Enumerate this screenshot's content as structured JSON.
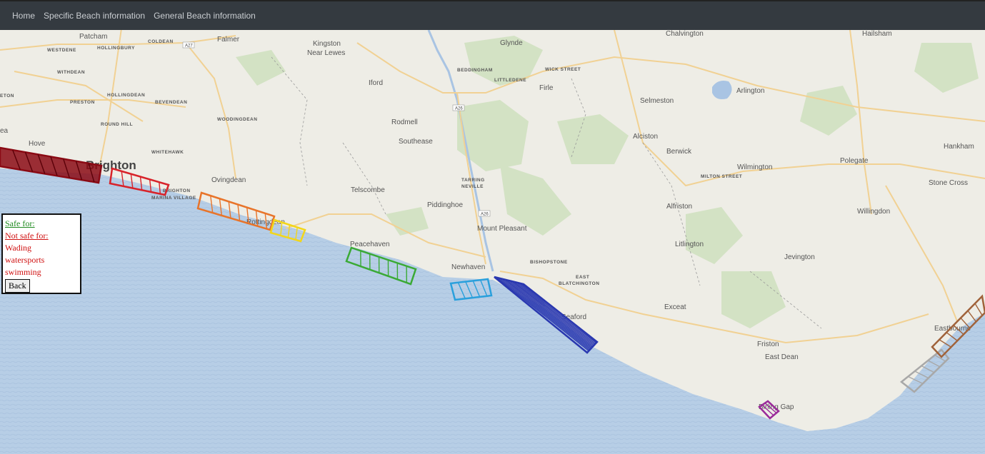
{
  "nav": {
    "items": [
      {
        "label": "Home"
      },
      {
        "label": "Specific Beach information"
      },
      {
        "label": "General Beach information"
      }
    ]
  },
  "map": {
    "colors": {
      "land": "#eeede6",
      "sea": "#b7cee6",
      "water_inland": "#a9c4e3",
      "park": "#cfe0bf",
      "road": "#f3d49a"
    },
    "places": [
      {
        "name": "Patcham",
        "style": "normal"
      },
      {
        "name": "WESTDENE",
        "style": "caps"
      },
      {
        "name": "HOLLINGBURY",
        "style": "caps"
      },
      {
        "name": "COLDEAN",
        "style": "caps"
      },
      {
        "name": "Falmer",
        "style": "normal"
      },
      {
        "name": "Kingston",
        "style": "normal"
      },
      {
        "name": "Near Lewes",
        "style": "normal"
      },
      {
        "name": "Glynde",
        "style": "normal"
      },
      {
        "name": "Chalvington",
        "style": "normal"
      },
      {
        "name": "Hailsham",
        "style": "normal"
      },
      {
        "name": "WITHDEAN",
        "style": "caps"
      },
      {
        "name": "HOLLINGDEAN",
        "style": "caps"
      },
      {
        "name": "PRESTON",
        "style": "caps"
      },
      {
        "name": "BEVENDEAN",
        "style": "caps"
      },
      {
        "name": "ETON",
        "style": "caps"
      },
      {
        "name": "BEDDINGHAM",
        "style": "caps"
      },
      {
        "name": "WICK STREET",
        "style": "caps"
      },
      {
        "name": "LITTLEDENE",
        "style": "caps"
      },
      {
        "name": "Iford",
        "style": "normal"
      },
      {
        "name": "Firle",
        "style": "normal"
      },
      {
        "name": "Arlington",
        "style": "normal"
      },
      {
        "name": "Selmeston",
        "style": "normal"
      },
      {
        "name": "WOODINGDEAN",
        "style": "caps"
      },
      {
        "name": "ROUND HILL",
        "style": "caps"
      },
      {
        "name": "Rodmell",
        "style": "normal"
      },
      {
        "name": "Hove",
        "style": "normal"
      },
      {
        "name": "ea",
        "style": "normal"
      },
      {
        "name": "WHITEHAWK",
        "style": "caps"
      },
      {
        "name": "Southease",
        "style": "normal"
      },
      {
        "name": "Alciston",
        "style": "normal"
      },
      {
        "name": "Berwick",
        "style": "normal"
      },
      {
        "name": "Hankham",
        "style": "normal"
      },
      {
        "name": "Brighton",
        "style": "big"
      },
      {
        "name": "Ovingdean",
        "style": "normal"
      },
      {
        "name": "Wilmington",
        "style": "normal"
      },
      {
        "name": "Polegate",
        "style": "normal"
      },
      {
        "name": "MILTON STREET",
        "style": "caps"
      },
      {
        "name": "TARRING",
        "style": "caps"
      },
      {
        "name": "NEVILLE",
        "style": "caps"
      },
      {
        "name": "Telscombe",
        "style": "normal"
      },
      {
        "name": "BRIGHTON",
        "style": "caps"
      },
      {
        "name": "MARINA VILLAGE",
        "style": "caps"
      },
      {
        "name": "Stone Cross",
        "style": "normal"
      },
      {
        "name": "Piddinghoe",
        "style": "normal"
      },
      {
        "name": "Alfriston",
        "style": "normal"
      },
      {
        "name": "Willingdon",
        "style": "normal"
      },
      {
        "name": "Rottingdean",
        "style": "normal"
      },
      {
        "name": "Mount Pleasant",
        "style": "normal"
      },
      {
        "name": "Peacehaven",
        "style": "normal"
      },
      {
        "name": "Litlington",
        "style": "normal"
      },
      {
        "name": "Jevington",
        "style": "normal"
      },
      {
        "name": "BISHOPSTONE",
        "style": "caps"
      },
      {
        "name": "Newhaven",
        "style": "normal"
      },
      {
        "name": "EAST",
        "style": "caps"
      },
      {
        "name": "BLATCHINGTON",
        "style": "caps"
      },
      {
        "name": "Exceat",
        "style": "normal"
      },
      {
        "name": "Seaford",
        "style": "normal"
      },
      {
        "name": "Eastbourne",
        "style": "normal"
      },
      {
        "name": "Friston",
        "style": "normal"
      },
      {
        "name": "East Dean",
        "style": "normal"
      },
      {
        "name": "Birling Gap",
        "style": "normal"
      }
    ],
    "roads": [
      "A27",
      "A26",
      "A26"
    ],
    "beach_zones": [
      {
        "name": "hove-beach",
        "color": "#8b0a14",
        "filled": true
      },
      {
        "name": "brighton-beach",
        "color": "#d8232a",
        "filled": false
      },
      {
        "name": "brighton-marina-beach",
        "color": "#e8742a",
        "filled": false
      },
      {
        "name": "rottingdean-beach",
        "color": "#f2d61a",
        "filled": false
      },
      {
        "name": "peacehaven-beach",
        "color": "#3aaa35",
        "filled": false
      },
      {
        "name": "newhaven-beach",
        "color": "#2aa0dc",
        "filled": false
      },
      {
        "name": "seaford-beach",
        "color": "#2a38b0",
        "filled": false
      },
      {
        "name": "birling-gap-beach",
        "color": "#9a2a9a",
        "filled": false
      },
      {
        "name": "eastbourne-west-beach",
        "color": "#a8a8a8",
        "filled": false
      },
      {
        "name": "eastbourne-beach",
        "color": "#a0623a",
        "filled": false
      }
    ]
  },
  "info": {
    "safe_title": "Safe for:",
    "unsafe_title": "Not safe for:",
    "unsafe_items": [
      "Wading",
      "watersports",
      "swimming"
    ],
    "back_label": "Back"
  }
}
